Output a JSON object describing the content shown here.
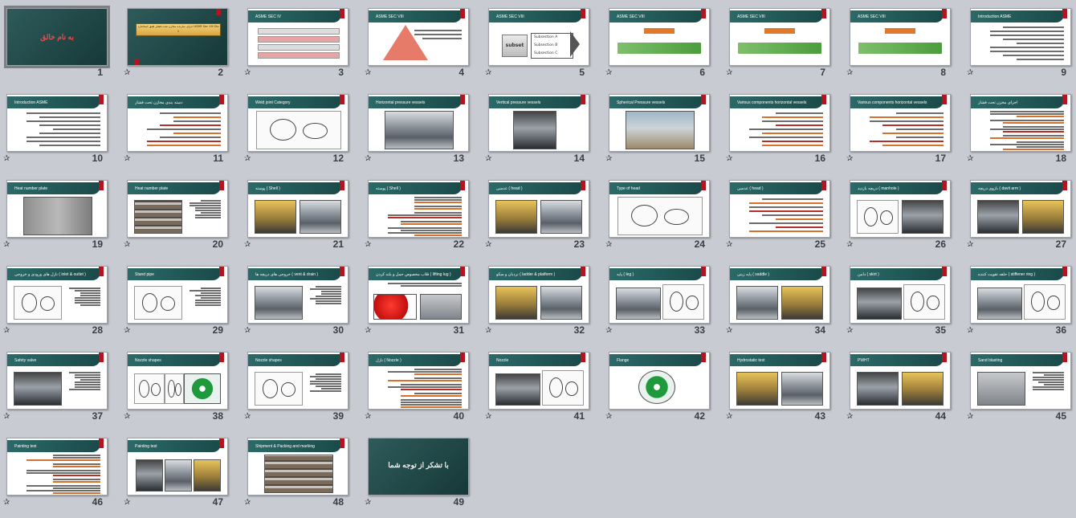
{
  "slides": [
    {
      "n": "1",
      "style": "dark-title",
      "title": "به نام خالق",
      "selected": true
    },
    {
      "n": "2",
      "style": "banner",
      "title": "",
      "banner": "اجزای سازنده مخازن تحت فشار طبق استاندارد ASME Sec VIII Div 1"
    },
    {
      "n": "3",
      "style": "stack",
      "title": "ASME SEC IV"
    },
    {
      "n": "4",
      "style": "pyramid",
      "title": "ASME SEC VIII"
    },
    {
      "n": "5",
      "style": "subset",
      "title": "ASME SEC VIII",
      "subset": "subset",
      "subs": [
        "Subsection A",
        "Subsection B",
        "Subsection C"
      ]
    },
    {
      "n": "6",
      "style": "green",
      "title": "ASME SEC VIII"
    },
    {
      "n": "7",
      "style": "green",
      "title": "ASME SEC VIII"
    },
    {
      "n": "8",
      "style": "green",
      "title": "ASME SEC VIII"
    },
    {
      "n": "9",
      "style": "text",
      "title": "Introduction ASME"
    },
    {
      "n": "10",
      "style": "text",
      "title": "Introduction ASME"
    },
    {
      "n": "11",
      "style": "text-color",
      "title": "دسته بندی مخازن تحت فشار"
    },
    {
      "n": "12",
      "style": "sketch",
      "title": "Weld joint Category"
    },
    {
      "n": "13",
      "style": "photo",
      "title": "Horizontal pressure vessels",
      "photo": "metal"
    },
    {
      "n": "14",
      "style": "photo-small",
      "title": "Vertical pressure vessels",
      "photo": "steel"
    },
    {
      "n": "15",
      "style": "photo",
      "title": "Spherical Pressure vessels",
      "photo": "site"
    },
    {
      "n": "16",
      "style": "text-color",
      "title": "Various components horizontal vessels"
    },
    {
      "n": "17",
      "style": "text-color",
      "title": "Various components horizontal vessels"
    },
    {
      "n": "18",
      "style": "dense",
      "title": "اجزای مخزن تحت فشار"
    },
    {
      "n": "19",
      "style": "photo",
      "title": "Heat number plate",
      "photo": "plate"
    },
    {
      "n": "20",
      "style": "photo-text",
      "title": "Heat number plate",
      "photo": "pipe"
    },
    {
      "n": "21",
      "style": "two-photo",
      "title": "پوسته ( Shell )",
      "photo": "warm"
    },
    {
      "n": "22",
      "style": "dense",
      "title": "پوسته ( Shell )"
    },
    {
      "n": "23",
      "style": "two-photo",
      "title": "عدسی ( head )",
      "photo": "warm"
    },
    {
      "n": "24",
      "style": "sketch",
      "title": "Type of head"
    },
    {
      "n": "25",
      "style": "text-color",
      "title": "عدسی ( head )"
    },
    {
      "n": "26",
      "style": "sketch-photo",
      "title": "دریچه بازدید ( manhole )"
    },
    {
      "n": "27",
      "style": "two-photo",
      "title": "بازوی دریچه ( davit arm )",
      "photo": "steel"
    },
    {
      "n": "28",
      "style": "sketch-text",
      "title": "نازل های ورودی و خروجی ( inlet & outlet )"
    },
    {
      "n": "29",
      "style": "sketch-text",
      "title": "Stand pipe"
    },
    {
      "n": "30",
      "style": "photo-text",
      "title": "خروجی های دریچه ها ( vent & drain )",
      "photo": "metal"
    },
    {
      "n": "31",
      "style": "red-photo",
      "title": "قلاب مخصوص حمل و بلند کردن ( lifting lug )"
    },
    {
      "n": "32",
      "style": "two-photo",
      "title": "نردبان و سکو ( ladder & platform )",
      "photo": "warm"
    },
    {
      "n": "33",
      "style": "photo-sketch",
      "title": "پایه ( leg )",
      "photo": "metal"
    },
    {
      "n": "34",
      "style": "two-photo",
      "title": "پایه زینی ( saddle )",
      "photo": "metal"
    },
    {
      "n": "35",
      "style": "photo-sketch",
      "title": "دامن ( skirt )",
      "photo": "steel"
    },
    {
      "n": "36",
      "style": "photo-sketch",
      "title": "حلقه تقویت کننده ( stiffener ring )",
      "photo": "metal"
    },
    {
      "n": "37",
      "style": "photo-text",
      "title": "Safety valve",
      "photo": "steel"
    },
    {
      "n": "38",
      "style": "sketch-green",
      "title": "Nozzle shapes"
    },
    {
      "n": "39",
      "style": "sketch-text",
      "title": "Nozzle shapes"
    },
    {
      "n": "40",
      "style": "dense",
      "title": "نازل ( Nozzle )"
    },
    {
      "n": "41",
      "style": "photo-sketch",
      "title": "Nozzle",
      "photo": "steel"
    },
    {
      "n": "42",
      "style": "flange",
      "title": "Flange"
    },
    {
      "n": "43",
      "style": "two-photo",
      "title": "Hydrostatic test",
      "photo": "warm"
    },
    {
      "n": "44",
      "style": "two-photo",
      "title": "PWHT",
      "photo": "steel"
    },
    {
      "n": "45",
      "style": "photo-text",
      "title": "Sand blasting",
      "photo": "gray"
    },
    {
      "n": "46",
      "style": "dense",
      "title": "Painting test"
    },
    {
      "n": "47",
      "style": "three-photo",
      "title": "Painting test",
      "photo": "steel"
    },
    {
      "n": "48",
      "style": "photo",
      "title": "Shipment & Packing and marking",
      "photo": "pipe"
    },
    {
      "n": "49",
      "style": "dark-title",
      "title": "با تشکر از توجه شما"
    }
  ]
}
